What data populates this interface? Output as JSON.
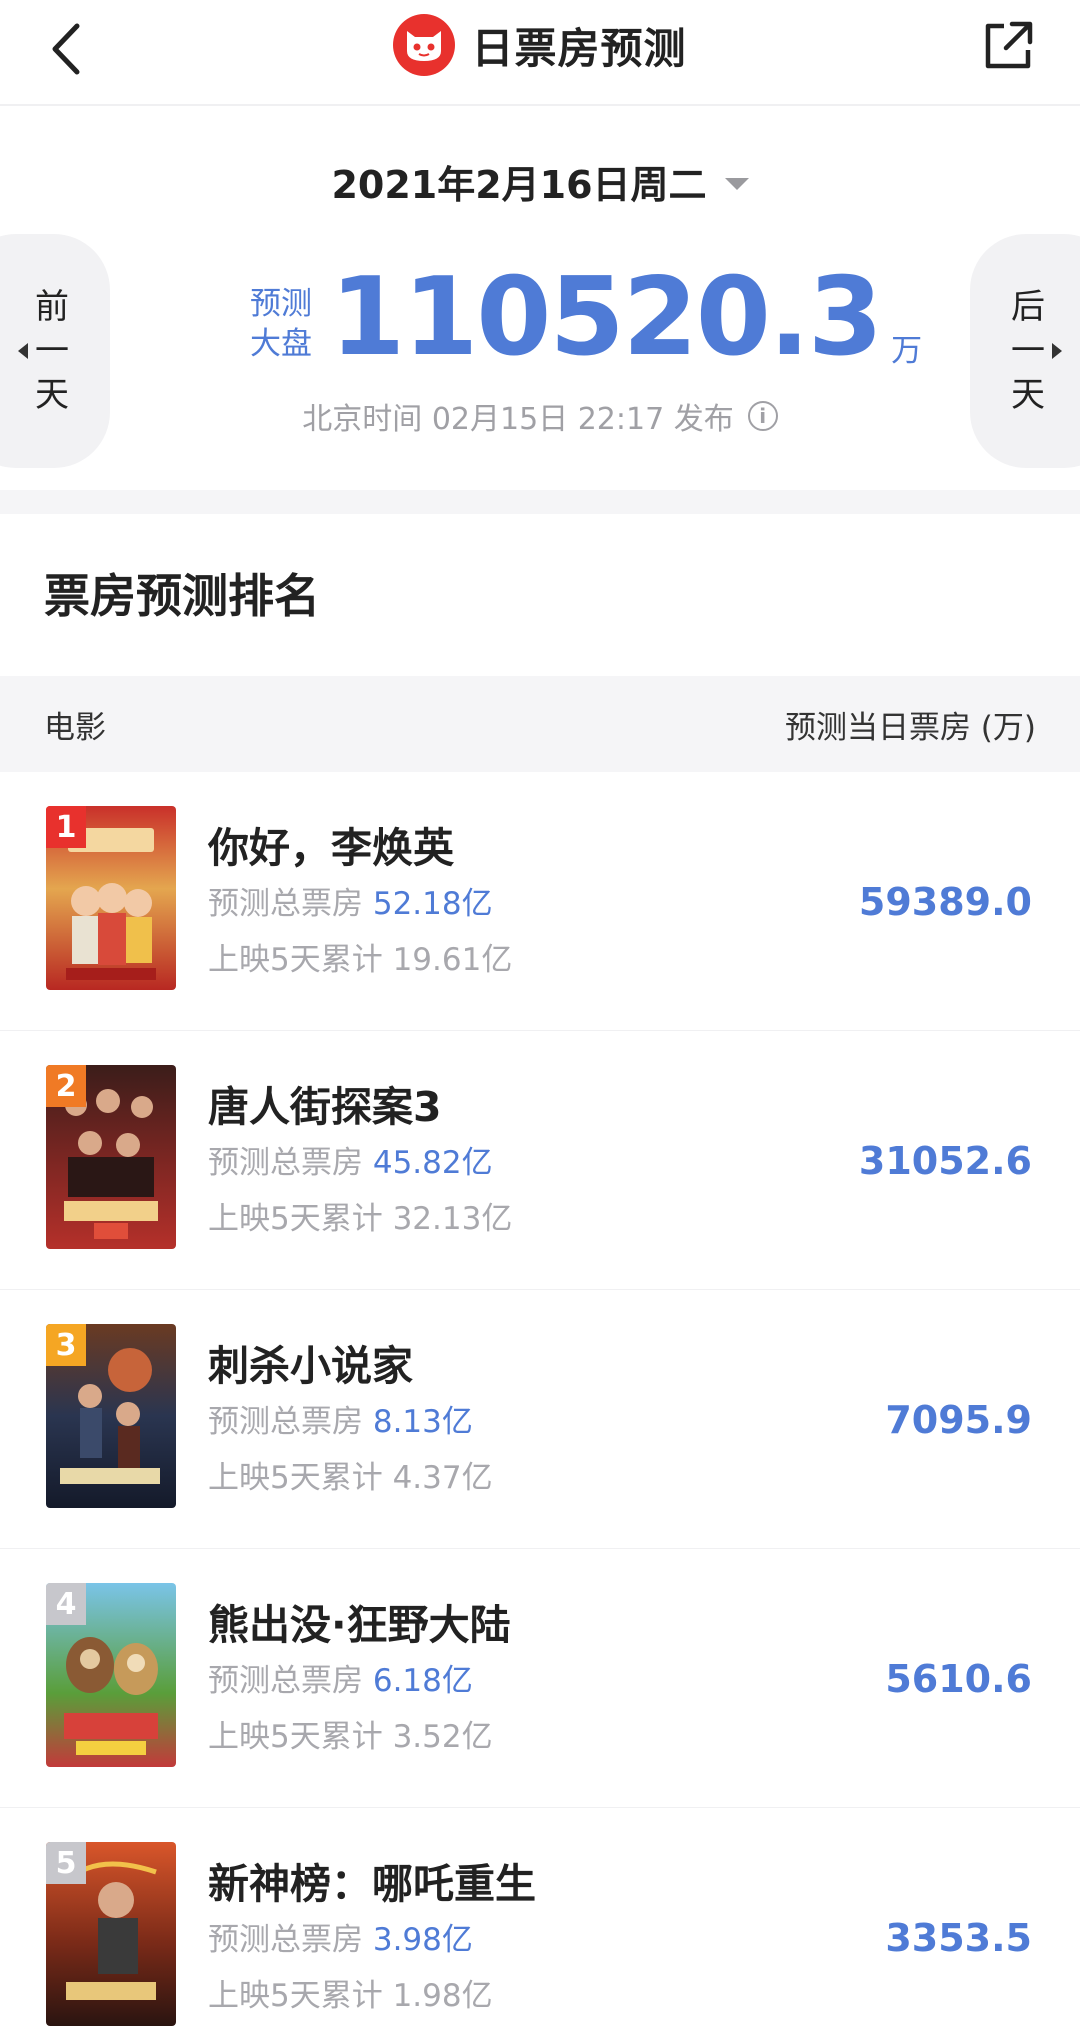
{
  "nav": {
    "title": "日票房预测",
    "icons": {
      "back": "chevron-left-icon",
      "logo": "maoyan-cat-logo",
      "share": "share-icon"
    }
  },
  "hero": {
    "date": "2021年2月16日周二",
    "prev_day": [
      "前",
      "一",
      "天"
    ],
    "next_day": [
      "后",
      "一",
      "天"
    ],
    "forecast_label": "预测大盘",
    "forecast_value": "110520.3",
    "forecast_unit": "万",
    "publish_text": "北京时间 02月15日 22:17 发布",
    "info_glyph": "i"
  },
  "ranking": {
    "section_title": "票房预测排名",
    "header_movie": "电影",
    "header_value": "预测当日票房 (万)",
    "total_label": "预测总票房",
    "items": [
      {
        "rank": "1",
        "title": "你好，李焕英",
        "predicted_total": "52.18亿",
        "cumulative": "上映5天累计 19.61亿",
        "daily": "59389.0"
      },
      {
        "rank": "2",
        "title": "唐人街探案3",
        "predicted_total": "45.82亿",
        "cumulative": "上映5天累计 32.13亿",
        "daily": "31052.6"
      },
      {
        "rank": "3",
        "title": "刺杀小说家",
        "predicted_total": "8.13亿",
        "cumulative": "上映5天累计 4.37亿",
        "daily": "7095.9"
      },
      {
        "rank": "4",
        "title": "熊出没·狂野大陆",
        "predicted_total": "6.18亿",
        "cumulative": "上映5天累计 3.52亿",
        "daily": "5610.6"
      },
      {
        "rank": "5",
        "title": "新神榜：哪吒重生",
        "predicted_total": "3.98亿",
        "cumulative": "上映5天累计 1.98亿",
        "daily": "3353.5"
      }
    ]
  },
  "colors": {
    "accent": "#4f7bd6",
    "brand": "#e8312d",
    "rank2": "#f07a25",
    "rank3": "#f5a623",
    "rank_other": "#c7c7cc"
  }
}
